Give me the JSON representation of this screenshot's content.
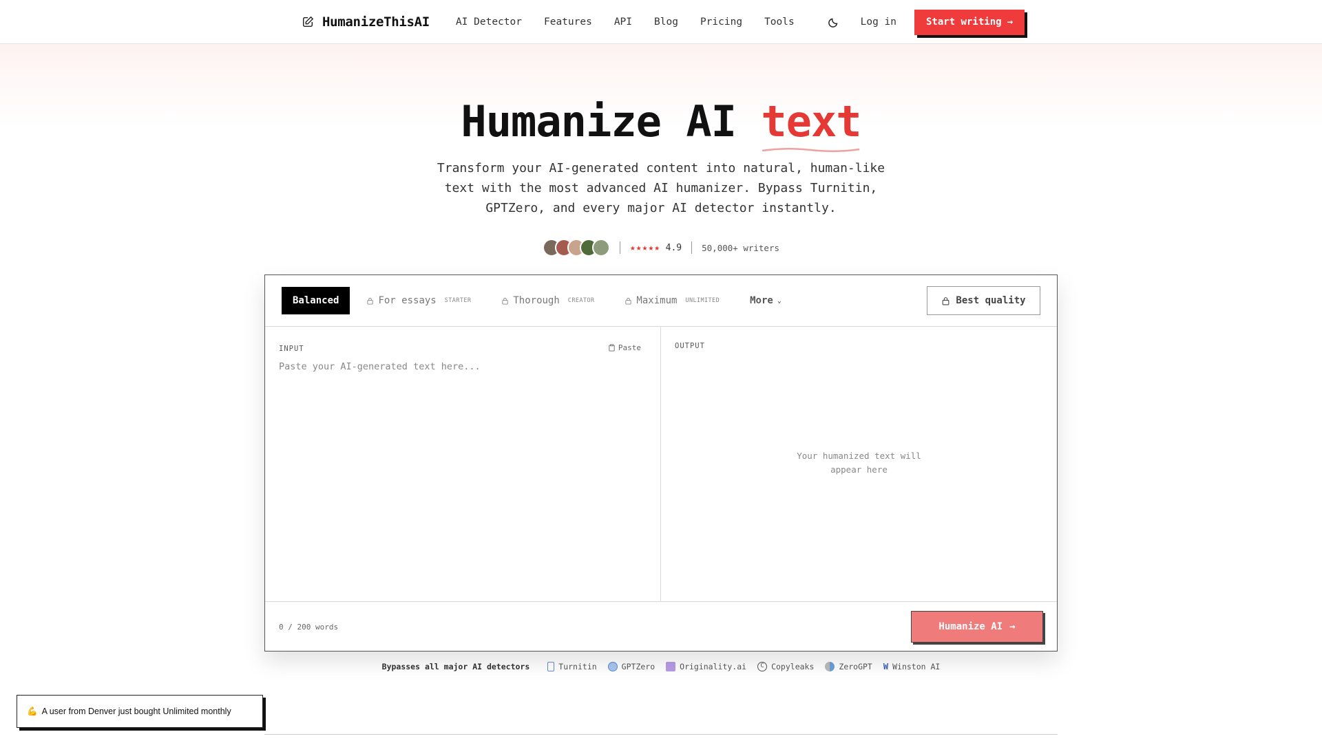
{
  "nav": {
    "brand": "HumanizeThisAI",
    "links": [
      "AI Detector",
      "Features",
      "API",
      "Blog",
      "Pricing",
      "Tools"
    ],
    "login": "Log in",
    "cta": "Start writing"
  },
  "hero": {
    "headline_main": "Humanize AI",
    "headline_accent": "text",
    "subtitle": "Transform your AI-generated content into natural, human-like text with the most advanced AI humanizer. Bypass Turnitin, GPTZero, and every major AI detector instantly.",
    "stars": "★★★★★",
    "rating": "4.9",
    "writers": "50,000+ writers"
  },
  "editor": {
    "tabs": [
      {
        "label": "Balanced",
        "tier": "",
        "locked": false
      },
      {
        "label": "For essays",
        "tier": "STARTER",
        "locked": true
      },
      {
        "label": "Thorough",
        "tier": "CREATOR",
        "locked": true
      },
      {
        "label": "Maximum",
        "tier": "UNLIMITED",
        "locked": true
      },
      {
        "label": "More",
        "tier": "",
        "locked": false
      }
    ],
    "best_quality": "Best quality",
    "input_label": "INPUT",
    "paste": "Paste",
    "input_placeholder": "Paste your AI-generated text here...",
    "output_label": "OUTPUT",
    "output_placeholder": "Your humanized text will appear here",
    "word_count": "0 / 200 words",
    "submit": "Humanize AI"
  },
  "detectors": {
    "lead": "Bypasses all major AI detectors",
    "items": [
      "Turnitin",
      "GPTZero",
      "Originality.ai",
      "Copyleaks",
      "ZeroGPT",
      "Winston AI"
    ]
  },
  "toast": {
    "emoji": "💪",
    "text": "A user from Denver just bought Unlimited monthly"
  },
  "colors": {
    "accent": "#e53935",
    "cta": "#ef3b3b",
    "submit": "#f07b7b"
  }
}
